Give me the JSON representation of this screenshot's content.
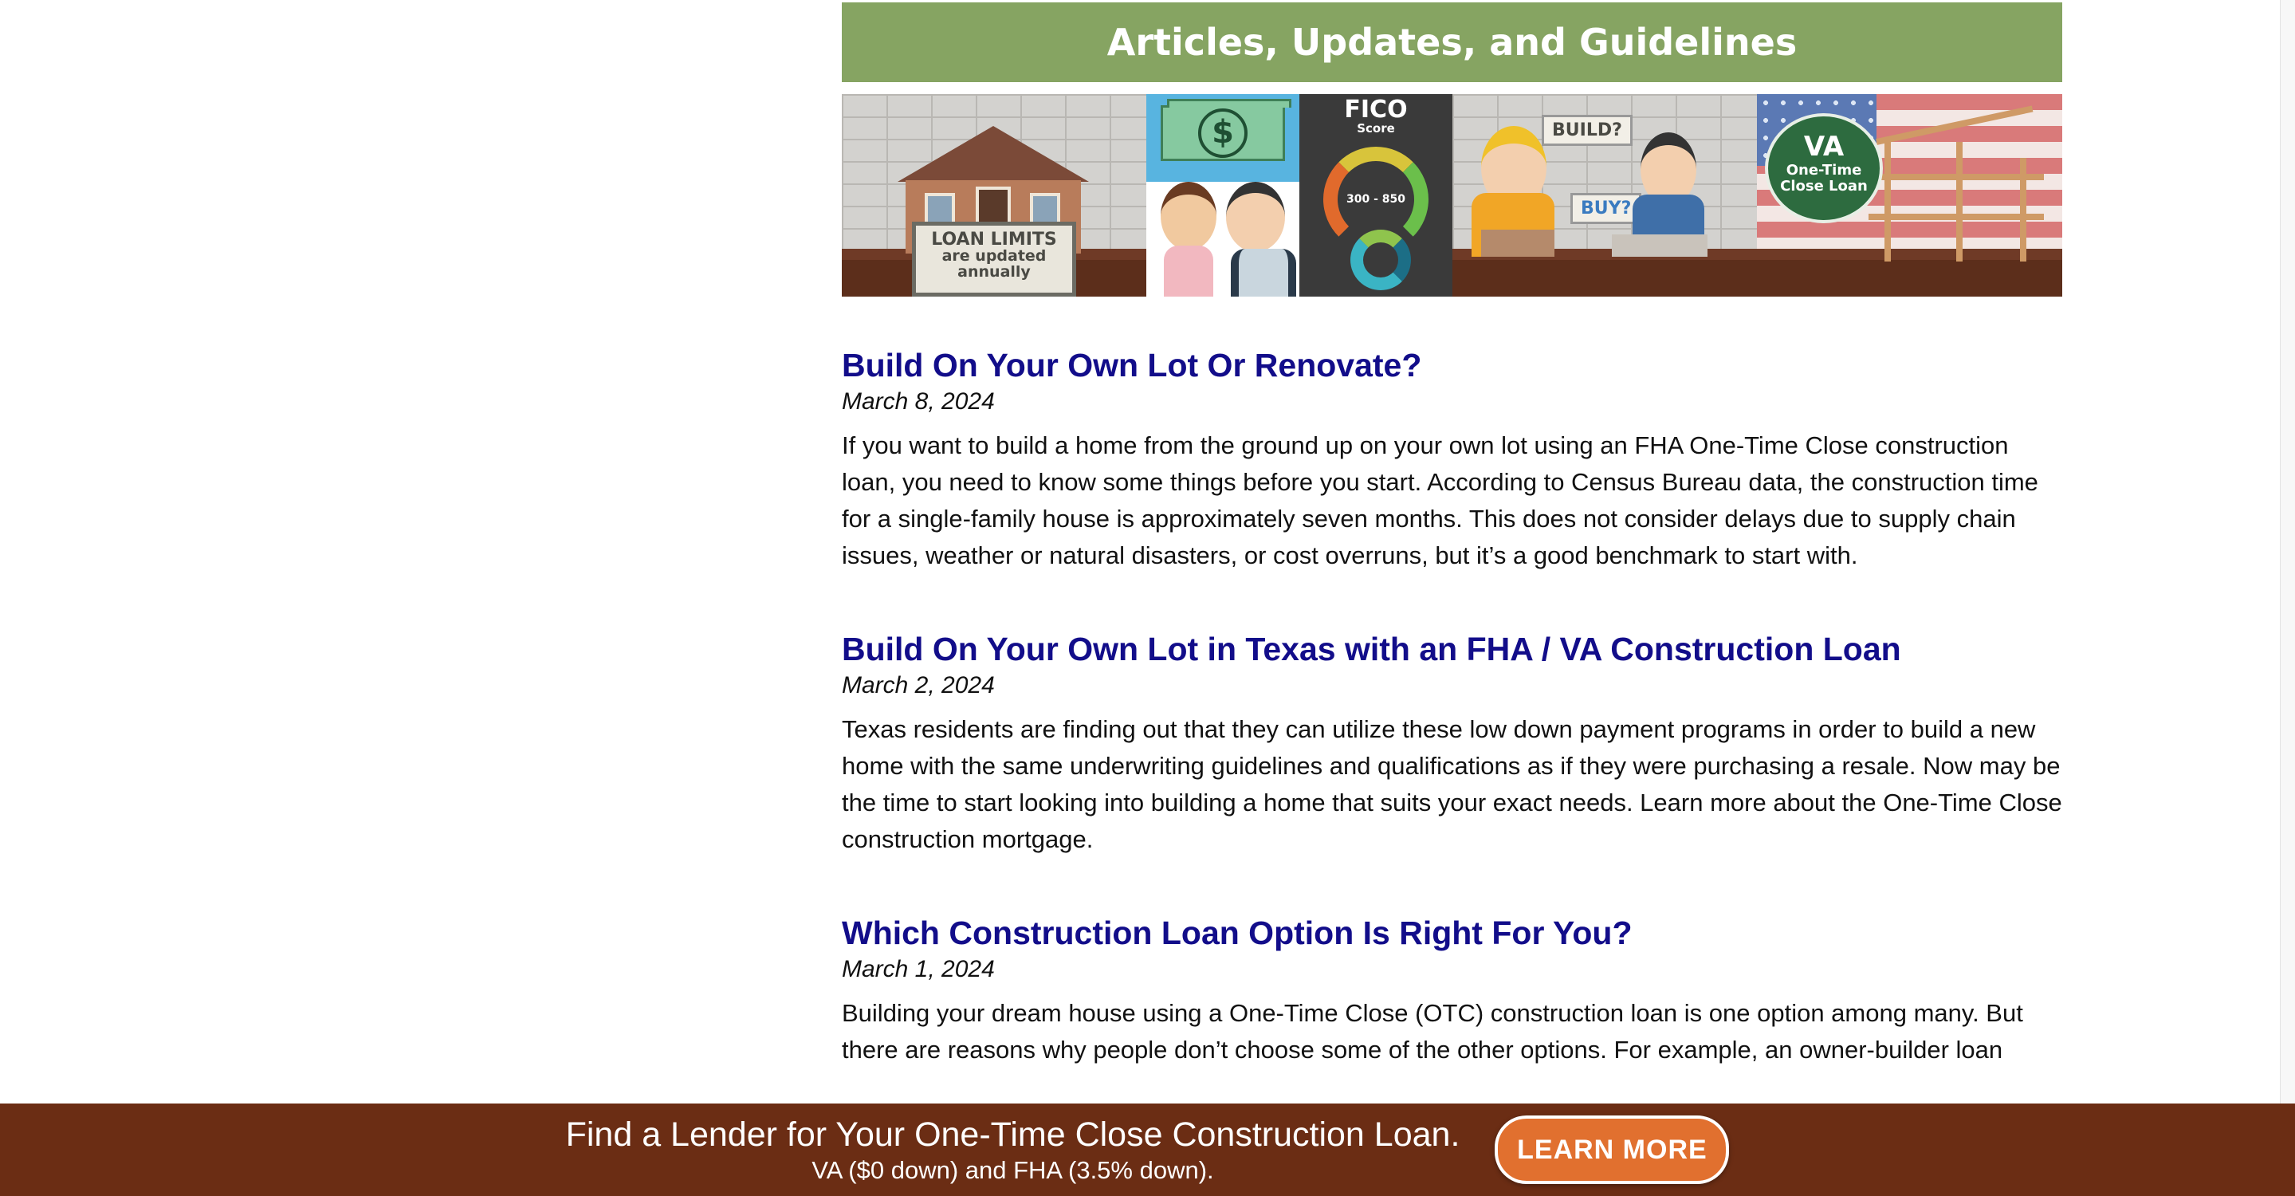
{
  "section": {
    "title": "Articles, Updates, and Guidelines"
  },
  "banner": {
    "loan_limits_line1": "LOAN LIMITS",
    "loan_limits_line2": "are updated",
    "loan_limits_line3": "annually",
    "fico_title": "FICO",
    "fico_sub": "Score",
    "fico_range": "300 - 850",
    "build_label": "BUILD?",
    "buy_label": "BUY?",
    "va_title": "VA",
    "va_line1": "One-Time",
    "va_line2": "Close Loan"
  },
  "articles": [
    {
      "title": "Build On Your Own Lot Or Renovate?",
      "date": "March 8, 2024",
      "excerpt": "If you want to build a home from the ground up on your own lot using an FHA One-Time Close construction loan, you need to know some things before you start. According to Census Bureau data, the construction time for a single-family house is approximately seven months. This does not consider delays due to supply chain issues, weather or natural disasters, or cost overruns, but it’s a good benchmark to start with."
    },
    {
      "title": "Build On Your Own Lot in Texas with an FHA / VA Construction Loan",
      "date": "March 2, 2024",
      "excerpt": "Texas residents are finding out that they can utilize these low down payment programs in order to build a new home with the same underwriting guidelines and qualifications as if they were purchasing a resale.  Now may be the time to start looking into building a home that suits your exact needs.  Learn more about the One-Time Close construction mortgage."
    },
    {
      "title": "Which Construction Loan Option Is Right For You?",
      "date": "March 1, 2024",
      "excerpt": "Building your dream house using a One-Time Close (OTC) construction loan is one option among many. But there are reasons why people don’t choose some of the other options. For example, an owner-builder loan"
    }
  ],
  "footer": {
    "headline": "Find a Lender for Your One-Time Close Construction Loan.",
    "subline": "VA ($0 down) and FHA (3.5% down).",
    "button_label": "LEARN MORE"
  },
  "colors": {
    "section_header": "#86a462",
    "link": "#120d8a",
    "footer_bar": "#6b2d14",
    "cta_button": "#e1702f"
  }
}
